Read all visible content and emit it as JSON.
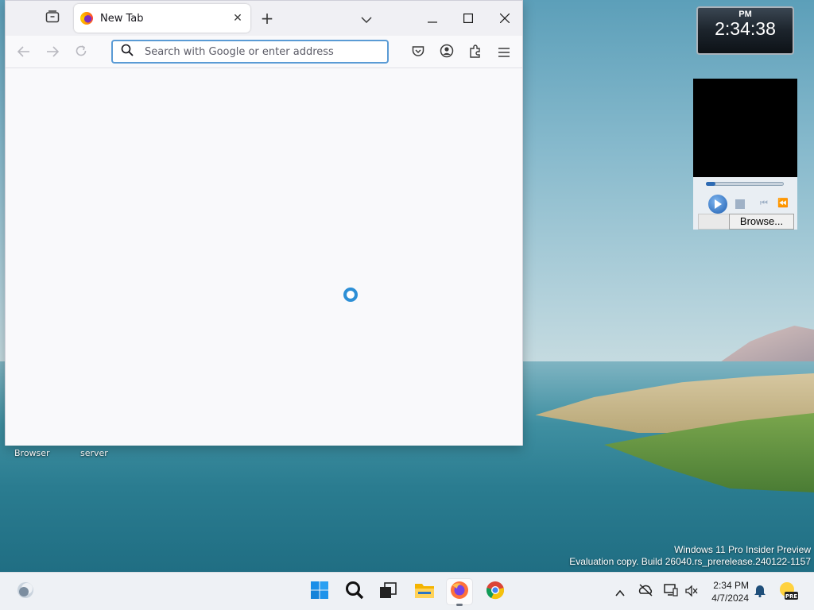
{
  "browser": {
    "tab_title": "New Tab",
    "url_placeholder": "Search with Google or enter address",
    "icons": {
      "tab_list": "firefox-view-icon",
      "favicon": "firefox-icon",
      "close_tab": "close-icon",
      "new_tab": "plus-icon",
      "list_all_tabs": "chevron-down-icon",
      "minimize": "minimize-icon",
      "maximize": "maximize-icon",
      "close_window": "close-icon",
      "back": "arrow-left-icon",
      "forward": "arrow-right-icon",
      "reload": "reload-icon",
      "search": "search-icon",
      "pocket": "pocket-icon",
      "account": "account-icon",
      "extensions": "puzzle-icon",
      "menu": "hamburger-icon"
    },
    "loading": true
  },
  "desktop": {
    "icon_labels": [
      "Browser",
      "server"
    ]
  },
  "clock_gadget": {
    "ampm": "PM",
    "time": "2:34:38"
  },
  "media_gadget": {
    "browse_label": "Browse...",
    "seek_fraction": 0.12
  },
  "watermark": {
    "line1": "Windows 11 Pro Insider Preview",
    "line2": "Evaluation copy. Build 26040.rs_prerelease.240122-1157"
  },
  "taskbar": {
    "apps": [
      "widgets-icon",
      "start-icon",
      "search-icon",
      "task-view-icon",
      "file-explorer-icon",
      "firefox-icon",
      "chrome-icon"
    ],
    "active_app": "firefox-icon",
    "tray": {
      "time": "2:34 PM",
      "date": "4/7/2024",
      "badge": "PRE"
    }
  },
  "colors": {
    "accent": "#2d8fd6",
    "urlbar_focus": "#5a9bd5",
    "tabbar_bg": "#f0f0f4",
    "taskbar_bg": "#eef1f5"
  }
}
